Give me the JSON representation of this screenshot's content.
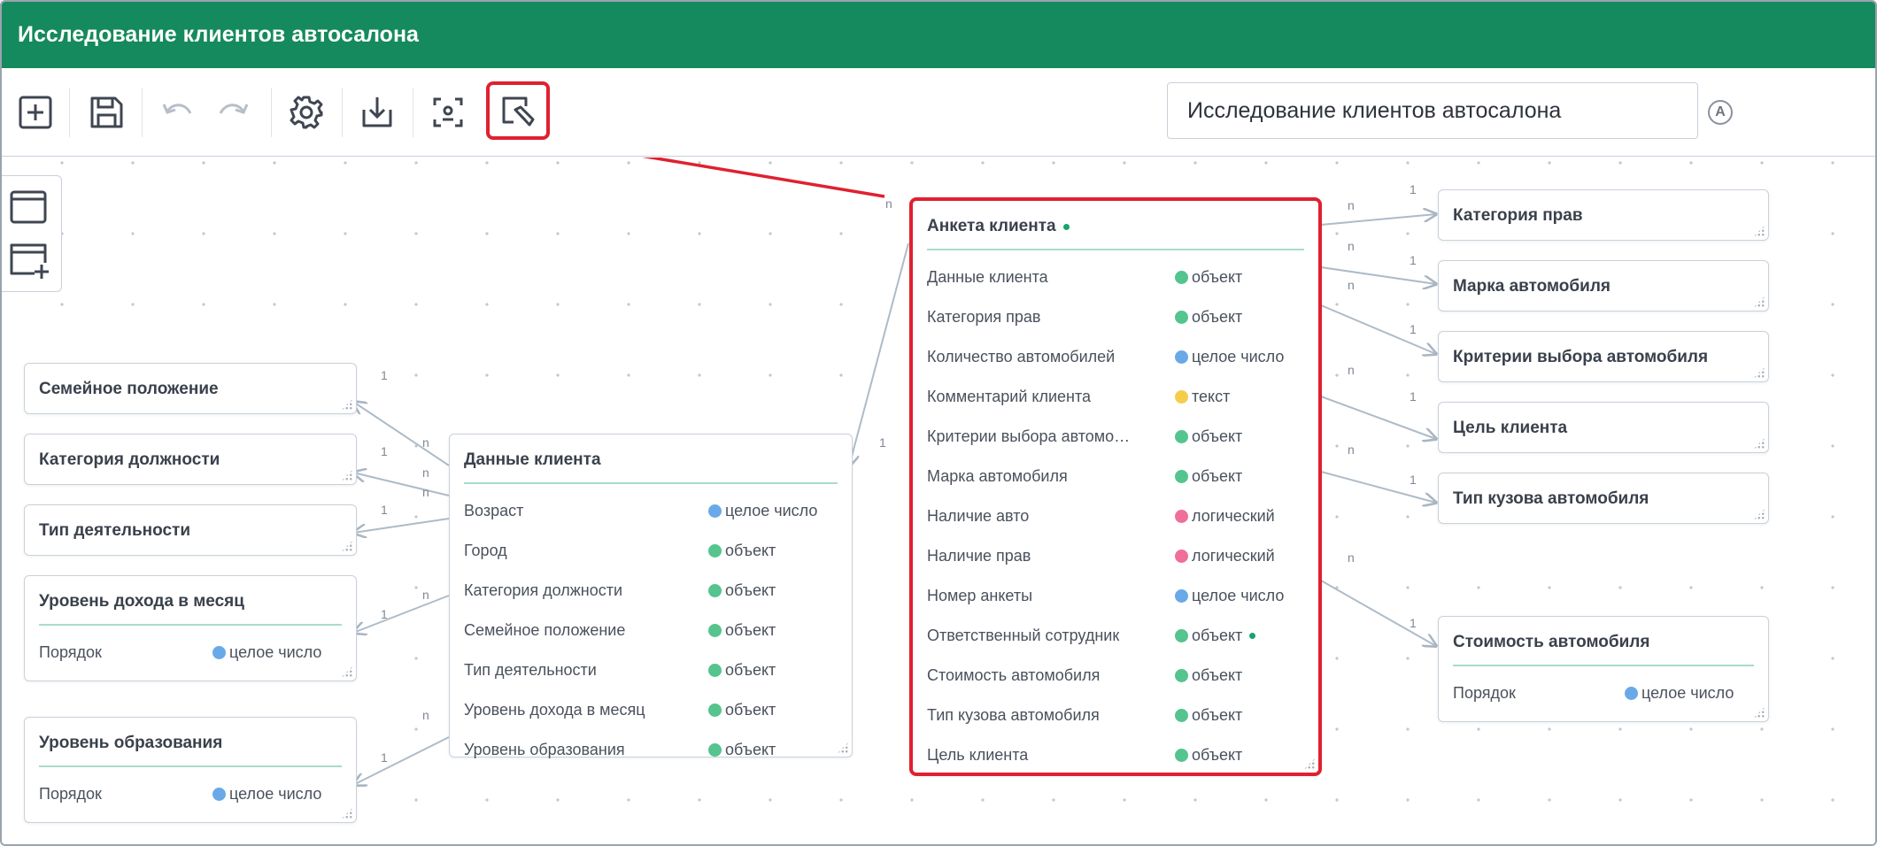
{
  "window": {
    "title": "Исследование клиентов автосалона"
  },
  "toolbar": {
    "name_value": "Исследование клиентов автосалона",
    "author_badge": "A"
  },
  "colors": {
    "titlebar": "#158a5e",
    "highlight": "#e02030",
    "type_object": "#55c48e",
    "type_integer": "#6aa9e8",
    "type_text": "#f5cd4a",
    "type_boolean": "#ef6f9a"
  },
  "types": {
    "object": "объект",
    "integer": "целое число",
    "text": "текст",
    "boolean": "логический"
  },
  "main_card": {
    "title": "Анкета клиента",
    "rows": [
      {
        "name": "Данные клиента",
        "type": "объект"
      },
      {
        "name": "Категория прав",
        "type": "объект"
      },
      {
        "name": "Количество автомобилей",
        "type": "целое число"
      },
      {
        "name": "Комментарий клиента",
        "type": "текст"
      },
      {
        "name": "Критерии выбора автомо…",
        "type": "объект"
      },
      {
        "name": "Марка автомобиля",
        "type": "объект"
      },
      {
        "name": "Наличие авто",
        "type": "логический"
      },
      {
        "name": "Наличие прав",
        "type": "логический"
      },
      {
        "name": "Номер анкеты",
        "type": "целое число"
      },
      {
        "name": "Ответственный сотрудник",
        "type": "объект"
      },
      {
        "name": "Стоимость автомобиля",
        "type": "объект"
      },
      {
        "name": "Тип кузова автомобиля",
        "type": "объект"
      },
      {
        "name": "Цель клиента",
        "type": "объект"
      }
    ]
  },
  "client_card": {
    "title": "Данные клиента",
    "rows": [
      {
        "name": "Возраст",
        "type": "целое число"
      },
      {
        "name": "Город",
        "type": "объект"
      },
      {
        "name": "Категория должности",
        "type": "объект"
      },
      {
        "name": "Семейное положение",
        "type": "объект"
      },
      {
        "name": "Тип деятельности",
        "type": "объект"
      },
      {
        "name": "Уровень дохода в месяц",
        "type": "объект"
      },
      {
        "name": "Уровень образования",
        "type": "объект"
      }
    ]
  },
  "left_cards": {
    "family": {
      "title": "Семейное положение"
    },
    "position": {
      "title": "Категория должности"
    },
    "activity": {
      "title": "Тип деятельности"
    },
    "income": {
      "title": "Уровень дохода в месяц",
      "row_name": "Порядок",
      "row_type": "целое число"
    },
    "education": {
      "title": "Уровень образования",
      "row_name": "Порядок",
      "row_type": "целое число"
    }
  },
  "right_cards": {
    "license": {
      "title": "Категория прав"
    },
    "brand": {
      "title": "Марка автомобиля"
    },
    "criteria": {
      "title": "Критерии выбора автомобиля"
    },
    "goal": {
      "title": "Цель клиента"
    },
    "body": {
      "title": "Тип кузова автомобиля"
    },
    "cost": {
      "title": "Стоимость автомобиля",
      "row_name": "Порядок",
      "row_type": "целое число"
    }
  },
  "edge_labels": {
    "one": "1",
    "many": "n"
  }
}
